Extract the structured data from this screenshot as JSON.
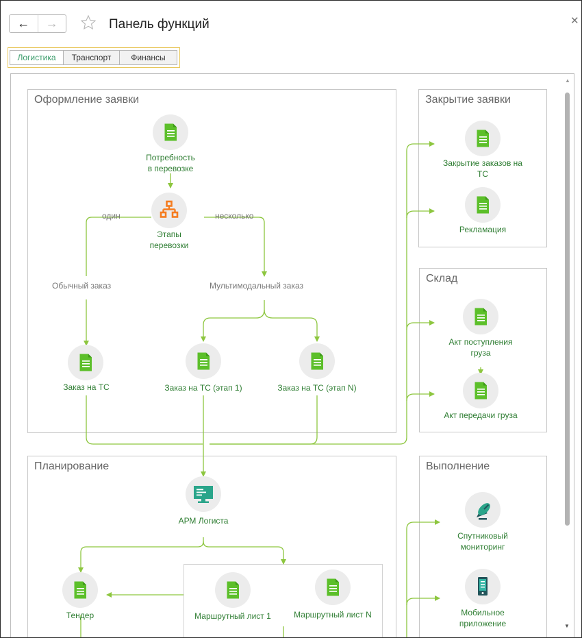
{
  "window": {
    "title": "Панель функций"
  },
  "tabs": [
    {
      "label": "Логистика",
      "active": true
    },
    {
      "label": "Транспорт",
      "active": false
    },
    {
      "label": "Финансы",
      "active": false
    }
  ],
  "groups": {
    "request": {
      "title": "Оформление заявки",
      "nodes": {
        "need": "Потребность\nв перевозке",
        "stages": "Этапы\nперевозки",
        "order": "Заказ на ТС",
        "order1": "Заказ на ТС (этап 1)",
        "orderN": "Заказ на ТС (этап N)"
      },
      "captions": {
        "one": "один",
        "several": "несколько",
        "regular": "Обычный заказ",
        "multimodal": "Мультимодальный заказ"
      }
    },
    "closing": {
      "title": "Закрытие заявки",
      "nodes": {
        "close_orders": "Закрытие заказов на\nТС",
        "complaint": "Рекламация"
      }
    },
    "warehouse": {
      "title": "Склад",
      "nodes": {
        "receipt": "Акт поступления\nгруза",
        "transfer": "Акт передачи груза"
      }
    },
    "planning": {
      "title": "Планирование",
      "nodes": {
        "arm": "АРМ Логиста",
        "tender": "Тендер",
        "route1": "Маршрутный лист 1",
        "routeN": "Маршрутный лист N"
      }
    },
    "execution": {
      "title": "Выполнение",
      "nodes": {
        "satellite": "Спутниковый\nмониторинг",
        "mobile": "Мобильное\nприложение"
      }
    }
  },
  "colors": {
    "doc_icon": "#5cbf2a",
    "hierarchy_icon": "#f57c1f",
    "monitor_icon": "#2aa58a",
    "connector": "#8dc63f",
    "node_label": "#2e7d32",
    "tab_highlight": "#e8c75b"
  }
}
